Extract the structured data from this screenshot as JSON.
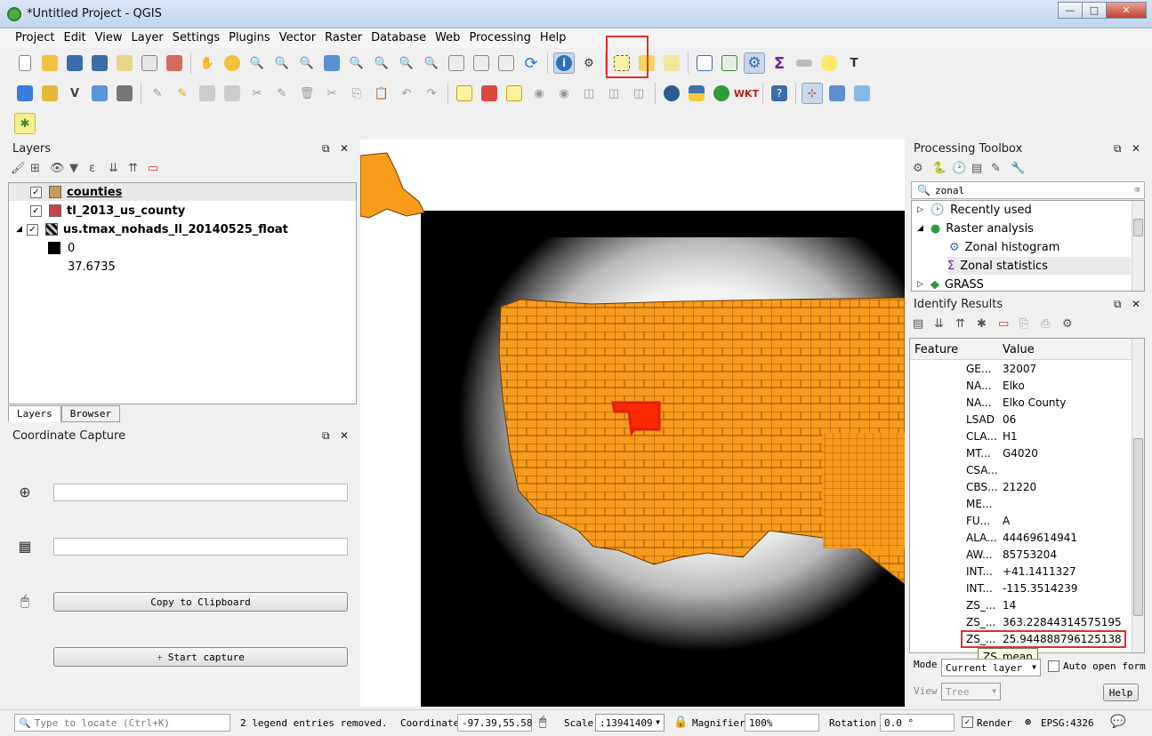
{
  "window": {
    "title": "*Untitled Project - QGIS"
  },
  "menu": [
    "Project",
    "Edit",
    "View",
    "Layer",
    "Settings",
    "Plugins",
    "Vector",
    "Raster",
    "Database",
    "Web",
    "Processing",
    "Help"
  ],
  "colors": {
    "accent_highlight": "#e0302a",
    "county_fill": "#f99b1c",
    "selected_county": "#ff2a00",
    "raster_dark": "#000000"
  },
  "layers_panel": {
    "title": "Layers",
    "items": [
      {
        "name": "counties",
        "swatch": "#c79c5b"
      },
      {
        "name": "tl_2013_us_county",
        "swatch": "#c94444"
      },
      {
        "name": "us.tmax_nohads_ll_20140525_float"
      }
    ],
    "raster_legend": {
      "min_label": "0",
      "max_label": "37.6735"
    },
    "tabs": [
      "Layers",
      "Browser"
    ]
  },
  "coordinate_capture": {
    "title": "Coordinate Capture",
    "copy_button": "Copy to Clipboard",
    "start_button": "Start capture"
  },
  "processing_toolbox": {
    "title": "Processing Toolbox",
    "search_value": "zonal",
    "tree": {
      "recently_used": "Recently used",
      "raster_analysis": "Raster analysis",
      "zonal_histogram": "Zonal histogram",
      "zonal_statistics": "Zonal statistics",
      "grass": "GRASS"
    }
  },
  "identify_results": {
    "title": "Identify Results",
    "col_feature": "Feature",
    "col_value": "Value",
    "rows": [
      {
        "field": "GE...",
        "value": "32007"
      },
      {
        "field": "NA...",
        "value": "Elko"
      },
      {
        "field": "NA...",
        "value": "Elko County"
      },
      {
        "field": "LSAD",
        "value": "06"
      },
      {
        "field": "CLA...",
        "value": "H1"
      },
      {
        "field": "MT...",
        "value": "G4020"
      },
      {
        "field": "CSA...",
        "value": ""
      },
      {
        "field": "CBS...",
        "value": "21220"
      },
      {
        "field": "ME...",
        "value": ""
      },
      {
        "field": "FU...",
        "value": "A"
      },
      {
        "field": "ALA...",
        "value": "44469614941"
      },
      {
        "field": "AW...",
        "value": "85753204"
      },
      {
        "field": "INT...",
        "value": "+41.1411327"
      },
      {
        "field": "INT...",
        "value": "-115.3514239"
      },
      {
        "field": "ZS_...",
        "value": "14"
      },
      {
        "field": "ZS_...",
        "value": "363.22844314575195"
      },
      {
        "field": "ZS_...",
        "value": "25.944888796125138"
      }
    ],
    "tooltip": "ZS_mean",
    "mode_label": "Mode",
    "mode_value": "Current layer",
    "auto_open_label": "Auto open form",
    "view_label": "View",
    "view_value": "Tree",
    "help_button": "Help"
  },
  "statusbar": {
    "locate_placeholder": "Type to locate (Ctrl+K)",
    "message": "2 legend entries removed.",
    "coordinate_label": "Coordinate",
    "coordinate_value": "-97.39,55.58",
    "scale_label": "Scale",
    "scale_value": ":13941409",
    "magnifier_label": "Magnifier",
    "magnifier_value": "100%",
    "rotation_label": "Rotation",
    "rotation_value": "0.0 °",
    "render_label": "Render",
    "crs": "EPSG:4326"
  }
}
